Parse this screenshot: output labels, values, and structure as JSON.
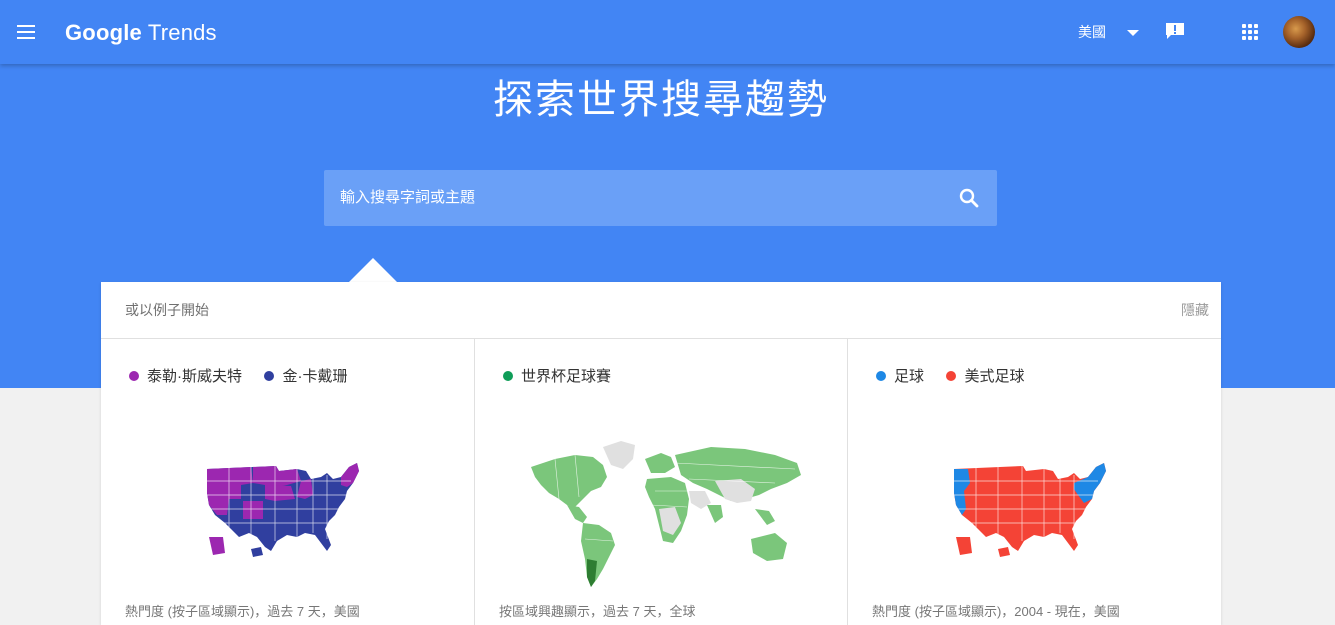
{
  "app": {
    "logo_google": "Google",
    "logo_trends": "Trends",
    "region": "美國"
  },
  "hero": {
    "headline": "探索世界搜尋趨勢",
    "search_placeholder": "輸入搜尋字詞或主題"
  },
  "examples": {
    "title": "或以例子開始",
    "hide_label": "隱藏",
    "items": [
      {
        "legend": [
          {
            "label": "泰勒·斯威夫特",
            "color": "#9c27b0"
          },
          {
            "label": "金·卡戴珊",
            "color": "#303f9f"
          }
        ],
        "caption": "熱門度 (按子區域顯示)，過去 7 天，美國"
      },
      {
        "legend": [
          {
            "label": "世界杯足球賽",
            "color": "#0f9d58"
          }
        ],
        "caption": "按區域興趣顯示，過去 7 天，全球"
      },
      {
        "legend": [
          {
            "label": "足球",
            "color": "#1e88e5"
          },
          {
            "label": "美式足球",
            "color": "#f44336"
          }
        ],
        "caption": "熱門度 (按子區域顯示)，2004 - 現在，美國"
      }
    ]
  }
}
